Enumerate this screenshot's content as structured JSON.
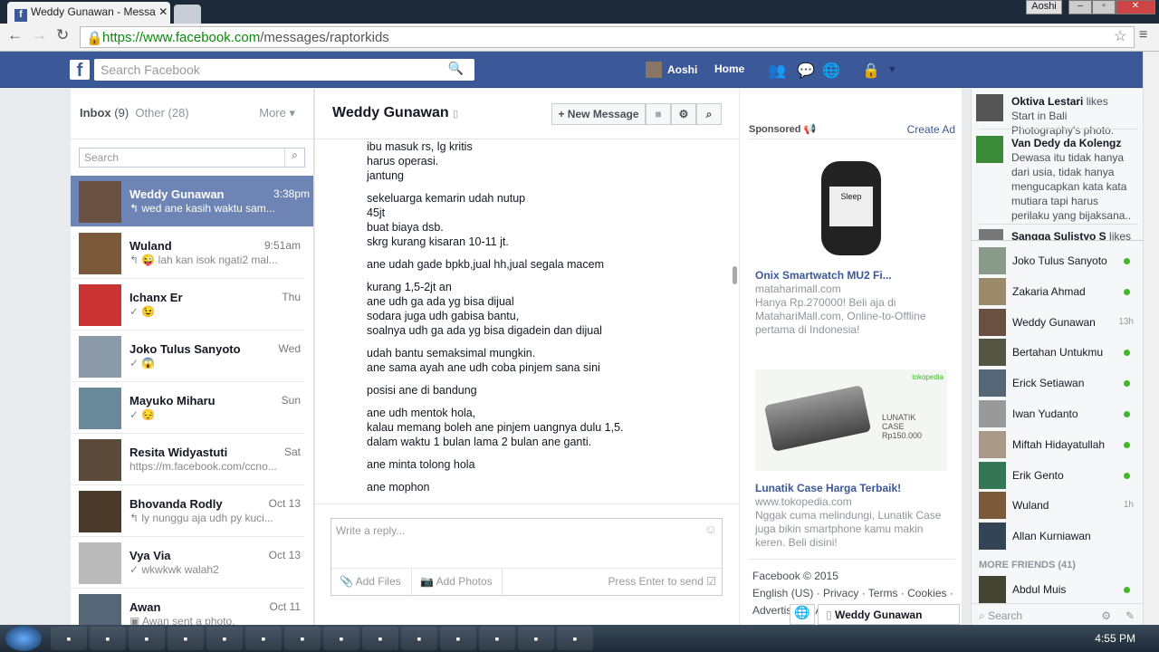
{
  "browser": {
    "tab_title": "Weddy Gunawan - Messa",
    "user": "Aoshi",
    "url_host": "https://www.facebook.com",
    "url_path": "/messages/raptorkids"
  },
  "header": {
    "search_placeholder": "Search Facebook",
    "user": "Aoshi",
    "home": "Home"
  },
  "inbox": {
    "inbox_label": "Inbox",
    "inbox_count": "(9)",
    "other_label": "Other (28)",
    "more": "More",
    "search_placeholder": "Search",
    "conversations": [
      {
        "name": "Weddy Gunawan",
        "time": "3:38pm",
        "preview": "↰ wed ane kasih waktu sam...",
        "color": "#6a5040"
      },
      {
        "name": "Wuland",
        "time": "9:51am",
        "preview": "↰ 😜 lah kan isok ngati2 mal...",
        "color": "#7a5a3a"
      },
      {
        "name": "Ichanx Er",
        "time": "Thu",
        "preview": "✓ 😉",
        "color": "#c33"
      },
      {
        "name": "Joko Tulus Sanyoto",
        "time": "Wed",
        "preview": "✓ 😱",
        "color": "#8a9aa8"
      },
      {
        "name": "Mayuko Miharu",
        "time": "Sun",
        "preview": "✓ 😔",
        "color": "#6a8a9a"
      },
      {
        "name": "Resita Widyastuti",
        "time": "Sat",
        "preview": "https://m.facebook.com/ccno...",
        "color": "#5a4a3a"
      },
      {
        "name": "Bhovanda Rodly",
        "time": "Oct 13",
        "preview": "↰ ly nunggu aja udh py kuci...",
        "color": "#4a3a2a"
      },
      {
        "name": "Vya Via",
        "time": "Oct 13",
        "preview": "✓ wkwkwk walah2",
        "color": "#bbb"
      },
      {
        "name": "Awan",
        "time": "Oct 11",
        "preview": "▣ Awan sent a photo.",
        "color": "#567"
      }
    ]
  },
  "conversation": {
    "title": "Weddy Gunawan",
    "new_message": "+ New Message",
    "messages": [
      [
        "ibu masuk rs, lg kritis",
        "harus operasi.",
        "jantung"
      ],
      [
        "sekeluarga kemarin udah nutup",
        "45jt",
        "buat biaya dsb.",
        "skrg kurang kisaran 10-11 jt."
      ],
      [
        "ane udah gade bpkb,jual hh,jual segala macem"
      ],
      [
        "kurang 1,5-2jt an",
        "ane udh ga ada yg bisa dijual",
        "sodara juga udh gabisa bantu,",
        "soalnya udh ga ada yg bisa digadein dan dijual"
      ],
      [
        "udah bantu semaksimal mungkin.",
        "ane sama ayah ane udh coba pinjem sana sini"
      ],
      [
        "posisi ane di bandung"
      ],
      [
        "ane udh mentok hola,",
        "kalau memang boleh ane pinjem uangnya dulu 1,5.",
        "dalam waktu 1 bulan lama 2 bulan ane ganti."
      ],
      [
        "ane minta tolong hola"
      ],
      [
        "ane mophon"
      ]
    ],
    "reply_placeholder": "Write a reply...",
    "add_files": "Add Files",
    "add_photos": "Add Photos",
    "press_enter": "Press Enter to send"
  },
  "ads": {
    "sponsored": "Sponsored",
    "create_ad": "Create Ad",
    "items": [
      {
        "title": "Onix Smartwatch MU2 Fi...",
        "domain": "mataharimall.com",
        "body": "Hanya Rp.270000! Beli aja di MatahariMall.com, Online-to-Offline pertama di Indonesia!",
        "image_text": "Sleep"
      },
      {
        "title": "Lunatik Case Harga Terbaik!",
        "domain": "www.tokopedia.com",
        "body": "Nggak cuma melindungi, Lunatik Case juga bikin smartphone kamu makin keren. Beli disini!",
        "image_text": "LUNATIK CASE Rp150.000",
        "brand": "tokopedia"
      }
    ],
    "footer_copy": "Facebook © 2015",
    "footer_links": "English (US) · Privacy · Terms · Cookies ·",
    "footer_links2": "Advertising · Ad Choices · More"
  },
  "ticker": [
    {
      "name": "Oktiva Lestari",
      "text": " likes Start in Bali Photography's photo."
    },
    {
      "name": "Van Dedy da Kolengz",
      "text": " Dewasa itu tidak hanya dari usia, tidak hanya mengucapkan kata kata mutiara tapi harus perilaku yang bijaksana.."
    },
    {
      "name": "Sangga Sulistyo S",
      "text": " likes"
    }
  ],
  "friends": [
    {
      "name": "Joko Tulus Sanyoto",
      "status": "online"
    },
    {
      "name": "Zakaria Ahmad",
      "status": "online"
    },
    {
      "name": "Weddy Gunawan",
      "status": "13h"
    },
    {
      "name": "Bertahan Untukmu",
      "status": "online"
    },
    {
      "name": "Erick Setiawan",
      "status": "online"
    },
    {
      "name": "Iwan Yudanto",
      "status": "online"
    },
    {
      "name": "Miftah Hidayatullah",
      "status": "online"
    },
    {
      "name": "Erik Gento",
      "status": "online"
    },
    {
      "name": "Wuland",
      "status": "1h"
    },
    {
      "name": "Allan Kurniawan",
      "status": ""
    }
  ],
  "more_friends": "MORE FRIENDS (41)",
  "more_friend": {
    "name": "Abdul Muis"
  },
  "chat_search": "Search",
  "chat_tab": "Weddy Gunawan",
  "clock": "4:55 PM"
}
